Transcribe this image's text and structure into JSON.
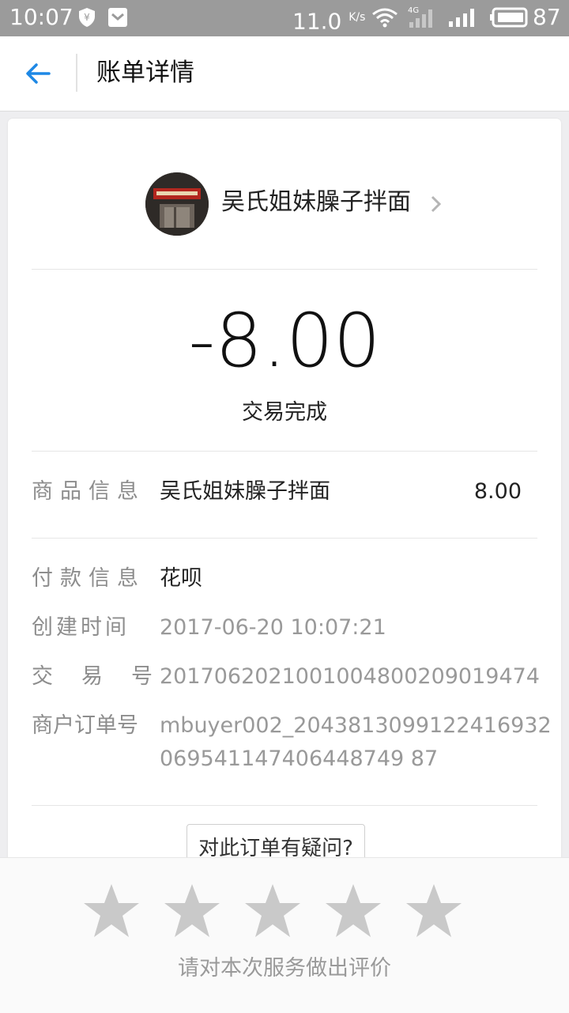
{
  "status_bar": {
    "time": "10:07",
    "net_speed": "11.0",
    "net_speed_unit": "K/s",
    "network_type": "4G",
    "battery": "87"
  },
  "header": {
    "title": "账单详情",
    "back_icon": "back-arrow-icon"
  },
  "merchant": {
    "name": "吴氏姐妹臊子拌面"
  },
  "transaction": {
    "amount": "-8.00",
    "status": "交易完成"
  },
  "details": {
    "product_label": "商品信息",
    "product_name": "吴氏姐妹臊子拌面",
    "product_price": "8.00",
    "payment_label": "付款信息",
    "payment_value": "花呗",
    "created_label": "创建时间",
    "created_value": "2017-06-20 10:07:21",
    "trade_no_label": "交易号",
    "trade_no_value": "2017062021001004800209019474",
    "merchant_order_label": "商户订单号",
    "merchant_order_line1": "mbuyer002_2043813099122416932",
    "merchant_order_line2": "069541147406448749 87"
  },
  "question_button": "对此订单有疑问?",
  "rating": {
    "prompt": "请对本次服务做出评价",
    "star_count": 5,
    "star_color": "#c9c9c9"
  },
  "colors": {
    "accent": "#1e88e5",
    "status_bar": "#9b9b9b"
  }
}
